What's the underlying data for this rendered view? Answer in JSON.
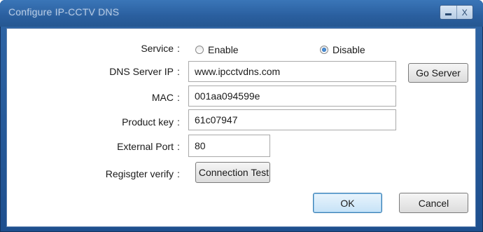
{
  "window": {
    "title": "Configure IP-CCTV DNS",
    "minimize_icon": "minimize-icon",
    "close_label": "X"
  },
  "service": {
    "label": "Service",
    "colon": ":",
    "options": [
      {
        "label": "Enable",
        "selected": false
      },
      {
        "label": "Disable",
        "selected": true
      }
    ]
  },
  "dns_server_ip": {
    "label": "DNS Server IP",
    "colon": ":",
    "value": "www.ipcctvdns.com",
    "go_button": "Go Server"
  },
  "mac": {
    "label": "MAC",
    "colon": ":",
    "value": "001aa094599e"
  },
  "product_key": {
    "label": "Product key",
    "colon": ":",
    "value": "61c07947"
  },
  "external_port": {
    "label": "External Port",
    "colon": ":",
    "value": "80"
  },
  "register_verify": {
    "label": "Regisgter verify",
    "colon": ":",
    "button": "Connection Test"
  },
  "actions": {
    "ok": "OK",
    "cancel": "Cancel"
  },
  "colors": {
    "titlebar": "#2a5f9f",
    "radio_selected": "#1f5fa8"
  }
}
